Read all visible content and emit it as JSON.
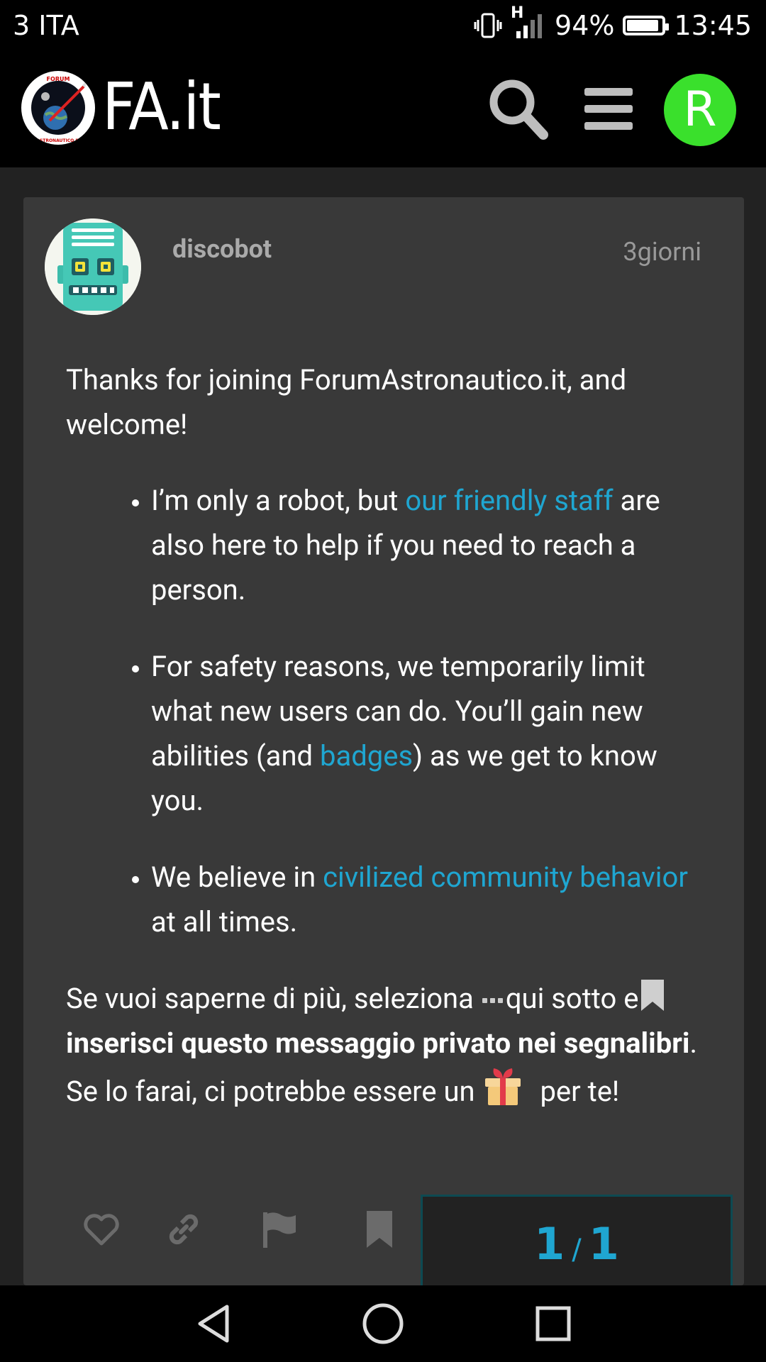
{
  "status_bar": {
    "carrier": "3 ITA",
    "network": "H",
    "battery": "94%",
    "time": "13:45"
  },
  "header": {
    "logo_text": "FA.it",
    "logo_badge_text_top": "FORUM",
    "logo_badge_text_bottom": "ASTRONAUTICO.IT",
    "avatar_letter": "R",
    "avatar_color": "#3ae02c"
  },
  "post": {
    "username": "discobot",
    "date": "3giorni",
    "intro": "Thanks for joining ForumAstronautico.it, and welcome!",
    "bullet1_pre": "I’m only a robot, but ",
    "bullet1_link": "our friendly staff",
    "bullet1_post": " are also here to help if you need to reach a person.",
    "bullet2_pre": "For safety reasons, we temporarily limit what new users can do. You’ll gain new abilities (and ",
    "bullet2_link": "badges",
    "bullet2_post": ") as we get to know you.",
    "bullet3_pre": "We believe in ",
    "bullet3_link": "civilized community behavior",
    "bullet3_post": " at all times.",
    "outro_1": "Se vuoi saperne di più, seleziona ",
    "outro_2": "qui sotto e",
    "outro_bold": "inserisci questo messaggio privato nei segnalibri",
    "outro_3": ". Se lo farai, ci potrebbe essere un ",
    "outro_4": " per te!"
  },
  "progress": {
    "current": "1",
    "separator": "/",
    "total": "1"
  },
  "colors": {
    "link": "#1fa6d1",
    "card_bg": "#393939",
    "page_bg": "#222222"
  },
  "icons": {
    "actions": [
      "heart-icon",
      "link-icon",
      "flag-icon",
      "bookmark-icon"
    ],
    "header": [
      "search-icon",
      "menu-icon"
    ],
    "nav": [
      "back-icon",
      "home-icon",
      "recents-icon"
    ]
  }
}
